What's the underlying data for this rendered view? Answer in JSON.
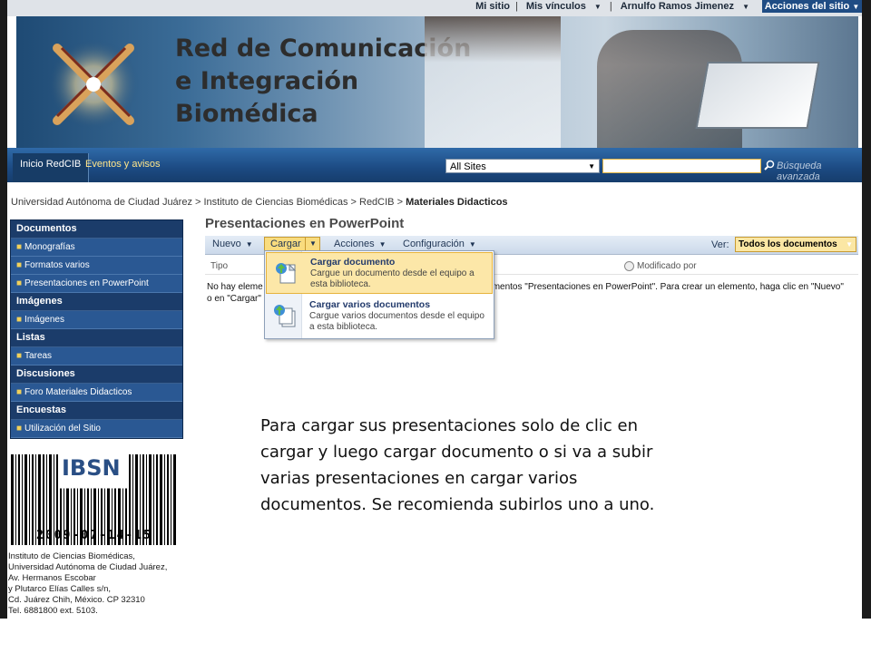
{
  "topbar": {
    "my_site": "Mi sitio",
    "my_links": "Mis vínculos",
    "user": "Arnulfo Ramos Jimenez",
    "site_actions": "Acciones del sitio"
  },
  "banner": {
    "title_line1": "Red de Comunicación",
    "title_line2": "e Integración",
    "title_line3": "Biomédica"
  },
  "nav": {
    "home": "Inicio RedCIB",
    "events": "Eventos y avisos",
    "scope": "All Sites",
    "advanced_search": "Búsqueda avanzada"
  },
  "breadcrumb": {
    "path": "Universidad Autónoma de Ciudad Juárez > Instituto de Ciencias Biomédicas > RedCIB > ",
    "current": "Materiales Didacticos"
  },
  "quicklaunch": {
    "sections": [
      {
        "title": "Documentos",
        "items": [
          "Monografías",
          "Formatos varios",
          "Presentaciones en PowerPoint"
        ]
      },
      {
        "title": "Imágenes",
        "items": [
          "Imágenes"
        ]
      },
      {
        "title": "Listas",
        "items": [
          "Tareas"
        ]
      },
      {
        "title": "Discusiones",
        "items": [
          "Foro Materiales Didacticos"
        ]
      },
      {
        "title": "Encuestas",
        "items": [
          "Utilización del Sitio"
        ]
      }
    ]
  },
  "barcode": {
    "label": "IBSN",
    "number": "2009-07-14-15"
  },
  "address": {
    "lines": [
      "Instituto de Ciencias Biomédicas,",
      "Universidad Autónoma de Ciudad Juárez,",
      "Av. Hermanos Escobar",
      "y Plutarco Elías Calles s/n,",
      "Cd. Juárez Chih, México. CP 32310",
      "Tel. 6881800 ext. 5103."
    ]
  },
  "main": {
    "title": "Presentaciones en PowerPoint",
    "toolbar": {
      "new": "Nuevo",
      "upload": "Cargar",
      "actions": "Acciones",
      "settings": "Configuración",
      "view_label": "Ver:",
      "view_value": "Todos los documentos"
    },
    "columns": {
      "type": "Tipo",
      "modified_by": "Modificado por"
    },
    "empty_message_1": "No hay eleme",
    "empty_message_1b": "mentos \"Presentaciones en PowerPoint\". Para crear un elemento, haga clic en \"Nuevo\"",
    "empty_message_2": "o en \"Cargar\"",
    "upload_menu": [
      {
        "title": "Cargar documento",
        "desc": "Cargue un documento desde el equipo a esta biblioteca."
      },
      {
        "title": "Cargar varios documentos",
        "desc": "Cargue varios documentos desde el equipo a esta biblioteca."
      }
    ]
  },
  "caption": "Para cargar sus presentaciones solo de clic en cargar y luego cargar documento o si va a subir varias presentaciones en cargar varios documentos. Se recomienda subirlos uno a uno.",
  "colors": {
    "nav_blue": "#1c4a82",
    "quicklaunch_blue": "#2a5893",
    "highlight_yellow": "#fce7a8"
  }
}
